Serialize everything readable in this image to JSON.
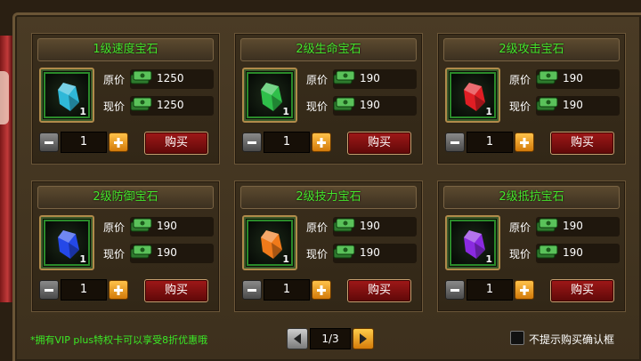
{
  "shop": {
    "gems": [
      {
        "title": "1级速度宝石",
        "color": "#2fb8d8",
        "count": "1",
        "original_label": "原价",
        "original_price": "1250",
        "current_label": "现价",
        "current_price": "1250",
        "quantity": "1",
        "buy_label": "购买"
      },
      {
        "title": "2级生命宝石",
        "color": "#2fbf4a",
        "count": "1",
        "original_label": "原价",
        "original_price": "190",
        "current_label": "现价",
        "current_price": "190",
        "quantity": "1",
        "buy_label": "购买"
      },
      {
        "title": "2级攻击宝石",
        "color": "#e01e24",
        "count": "1",
        "original_label": "原价",
        "original_price": "190",
        "current_label": "现价",
        "current_price": "190",
        "quantity": "1",
        "buy_label": "购买"
      },
      {
        "title": "2级防御宝石",
        "color": "#2448e8",
        "count": "1",
        "original_label": "原价",
        "original_price": "190",
        "current_label": "现价",
        "current_price": "190",
        "quantity": "1",
        "buy_label": "购买"
      },
      {
        "title": "2级技力宝石",
        "color": "#f07a1a",
        "count": "1",
        "original_label": "原价",
        "original_price": "190",
        "current_label": "现价",
        "current_price": "190",
        "quantity": "1",
        "buy_label": "购买"
      },
      {
        "title": "2级抵抗宝石",
        "color": "#8a2ae0",
        "count": "1",
        "original_label": "原价",
        "original_price": "190",
        "current_label": "现价",
        "current_price": "190",
        "quantity": "1",
        "buy_label": "购买"
      }
    ],
    "vip_notice": "*拥有VIP plus特权卡可以享受8折优惠哦",
    "page_indicator": "1/3",
    "confirm_checkbox_label": "不提示购买确认框",
    "confirm_checked": false
  }
}
